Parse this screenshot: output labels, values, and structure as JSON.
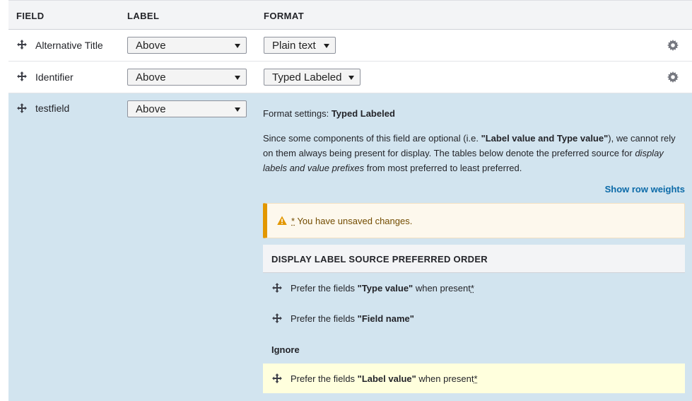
{
  "header": {
    "field": "FIELD",
    "label": "LABEL",
    "format": "FORMAT"
  },
  "rows": [
    {
      "name": "Alternative Title",
      "label": "Above",
      "format": "Plain text"
    },
    {
      "name": "Identifier",
      "label": "Above",
      "format": "Typed Labeled"
    },
    {
      "name": "testfield",
      "label": "Above"
    }
  ],
  "format_settings": {
    "prefix": "Format settings:",
    "formatter": "Typed Labeled",
    "desc_1": "Since some components of this field are optional (i.e. ",
    "desc_bold": "\"Label value and Type value\"",
    "desc_2": "), we cannot rely on them always being present for display. The tables below denote the preferred source for ",
    "desc_italic": "display labels and value prefixes",
    "desc_3": " from most preferred to least preferred.",
    "show_row_weights": "Show row weights"
  },
  "warning": {
    "star": "*",
    "message": "You have unsaved changes."
  },
  "order_table": {
    "heading": "DISPLAY LABEL SOURCE PREFERRED ORDER",
    "rows": [
      {
        "prefix": "Prefer the fields ",
        "field": "\"Type value\"",
        "suffix": " when present",
        "star": "*"
      },
      {
        "prefix": "Prefer the fields ",
        "field": "\"Field name\"",
        "suffix": "",
        "star": ""
      }
    ],
    "ignore_label": "Ignore",
    "ignored_rows": [
      {
        "prefix": "Prefer the fields ",
        "field": "\"Label value\"",
        "suffix": " when present",
        "star": "*"
      }
    ]
  },
  "colors": {
    "active_row_bg": "#d2e4ef",
    "warning_border": "#e29700",
    "link": "#0b6aa8",
    "highlight_row": "#ffffdd"
  }
}
